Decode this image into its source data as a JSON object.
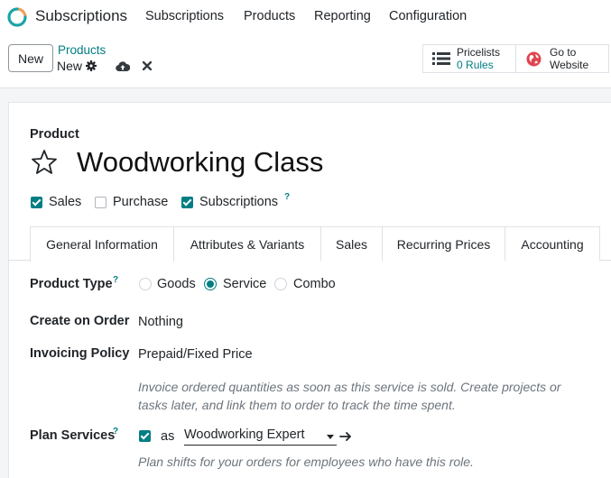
{
  "navbar": {
    "app_name": "Subscriptions",
    "menu": [
      "Subscriptions",
      "Products",
      "Reporting",
      "Configuration"
    ]
  },
  "control": {
    "new_label": "New",
    "breadcrumb_parent": "Products",
    "breadcrumb_current": "New",
    "pricelists": {
      "label": "Pricelists",
      "count": "0",
      "unit": "Rules"
    },
    "website": {
      "line1": "Go to",
      "line2": "Website"
    }
  },
  "product": {
    "section_label": "Product",
    "name": "Woodworking Class",
    "checkboxes": [
      {
        "label": "Sales",
        "checked": true
      },
      {
        "label": "Purchase",
        "checked": false
      },
      {
        "label": "Subscriptions",
        "checked": true
      }
    ],
    "help_mark": "?"
  },
  "tabs": [
    "General Information",
    "Attributes & Variants",
    "Sales",
    "Recurring Prices",
    "Accounting"
  ],
  "form": {
    "product_type": {
      "label": "Product Type",
      "options": [
        "Goods",
        "Service",
        "Combo"
      ],
      "selected": "Service"
    },
    "create_on_order": {
      "label": "Create on Order",
      "value": "Nothing"
    },
    "invoicing_policy": {
      "label": "Invoicing Policy",
      "value": "Prepaid/Fixed Price",
      "help_line1": "Invoice ordered quantities as soon as this service is sold. Create projects or",
      "help_line2": "tasks later, and link them to order to track the time spent."
    },
    "plan_services": {
      "label": "Plan Services",
      "checked": true,
      "as_text": "as",
      "role": "Woodworking Expert",
      "help": "Plan shifts for your orders for employees who have this role."
    }
  },
  "colors": {
    "accent": "#017e84",
    "logo_orange": "#f0a05a",
    "logo_teal": "#1ba5a9",
    "website_red": "#e0454f"
  }
}
